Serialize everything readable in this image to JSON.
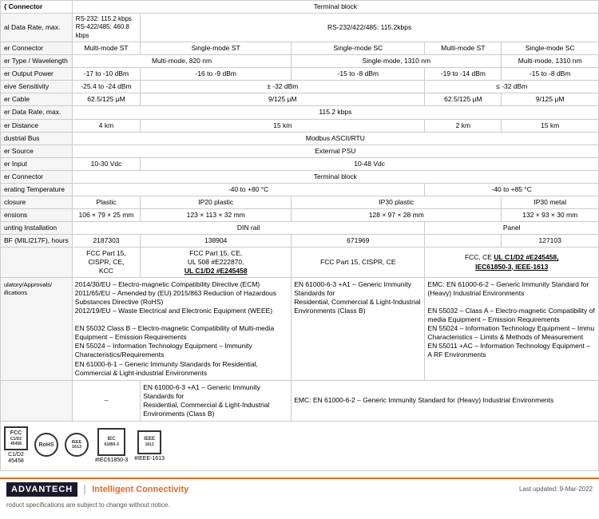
{
  "table": {
    "headers": {
      "col1": "",
      "col2": "Terminal block",
      "col3": "RS-232/422/485: 115.2kbps",
      "col4": "",
      "col5": "",
      "col6": ""
    },
    "rows": [
      {
        "label": "{ Connector",
        "values": [
          "Terminal block",
          "",
          "",
          "",
          ""
        ]
      },
      {
        "label": "al Data Rate, max.",
        "values": [
          "RS-232: 115.2 kbps\nRS-422/485: 460.8 kbps",
          "RS-232/422/485: 115.2kbps",
          "",
          "",
          ""
        ]
      },
      {
        "label": "er Connector",
        "values": [
          "Multi-mode ST",
          "Single-mode ST",
          "Single-mode SC",
          "Multi-mode ST",
          "Single-mode SC"
        ]
      },
      {
        "label": "er Type / Wavelength",
        "values": [
          "Multi-mode, 820 nm",
          "Single-mode, 1310 nm",
          "",
          "Multi-mode, 1310 nm",
          "Single-mode, 1310"
        ]
      },
      {
        "label": "er Output Power",
        "values": [
          "-17 to -10 dBm",
          "-16 to -9 dBm",
          "-15 to -8 dBm",
          "-19 to -14 dBm",
          "-15 to -8 dBm"
        ]
      },
      {
        "label": "eive Sensitivity",
        "values": [
          "-25.4 to -24 dBm",
          "± -32 dBm",
          "",
          "≤ -32 dBm",
          ""
        ]
      },
      {
        "label": "er Cable",
        "values": [
          "62.5/125 μM",
          "9/125 μM",
          "",
          "62.5/125 μM",
          "9/125 μM"
        ]
      },
      {
        "label": "er Data Rate, max.",
        "values": [
          "115.2 kbps",
          "",
          "",
          "",
          ""
        ]
      },
      {
        "label": "er Distance",
        "values": [
          "4 km",
          "15 km",
          "",
          "2 km",
          "15 km"
        ]
      },
      {
        "label": "dustrial Bus",
        "values": [
          "Modbus ASCII/RTU",
          "",
          "",
          "",
          ""
        ]
      },
      {
        "label": "er Source",
        "values": [
          "External PSU",
          "",
          "",
          "",
          ""
        ]
      },
      {
        "label": "er Input",
        "values": [
          "10-30 Vdc",
          "10-48 Vdc",
          "",
          "",
          ""
        ]
      },
      {
        "label": "er Connector",
        "values": [
          "Terminal block",
          "",
          "",
          "",
          ""
        ]
      },
      {
        "label": "erating Temperature",
        "values": [
          "-40 to +80 °C",
          "",
          "",
          "-40 to +85 °C",
          ""
        ]
      },
      {
        "label": "closure",
        "values": [
          "Plastic",
          "IP20 plastic",
          "IP30 plastic",
          "",
          "IP30 metal"
        ]
      },
      {
        "label": "ensions",
        "values": [
          "106 × 79 × 25 mm",
          "123 × 113 × 32 mm",
          "128 × 97 × 28 mm",
          "",
          "132 × 93 × 30 mm"
        ]
      },
      {
        "label": "unting Installation",
        "values": [
          "DIN rail",
          "",
          "",
          "Panel",
          ""
        ]
      },
      {
        "label": "BF (MILI217F), hours",
        "values": [
          "2187303",
          "138904",
          "671969",
          "",
          "127103"
        ]
      },
      {
        "label": "",
        "values": [
          "FCC Part 15, CISPR, CE, KCC",
          "FCC Part 15, CE,\nUL 508 #E222870,\nUL C1/D2 #E245458",
          "FCC Part 15, CISPR, CE",
          "FCC, CE UL C1/D2 #E245458,\nIEC61850-3, IEEE-1613",
          ""
        ]
      }
    ],
    "reg_row": {
      "label": "ulatory/Approvals/\nifications",
      "col_left": "2014/30/EU – Electro-magnetic Compatibility Directive (ECM)\n2011/65/EU – Amended by (EU) 2015/863 Reduction of Hazardous Substances Directive (RoHS)\n2012/19/EU – Waste Electrical and Electronic Equipment (WEEE)\n\nEN 55032 Class B – Electro-magnetic Compatibility of Multi-media Equipment – Emission Requirements\nEN 55024 – Information Technology Equipment – Immunity Characteristics/Requirements\nEN 61000-6-1 – Generic Immunity Standards for Residential, Commercial & Light-industrial Environments",
      "col_mid": "EN 61000-6-3 +A1 – Generic Immunity Standards for\nResidential, Commercial & Light-Industrial Environments (Class B)",
      "col_right": "EMC: EN 61000-6-2 – Generic Immunity Standard for (Heavy) Industrial Environments\n\nEN 55032 – Class A – Electro-magnetic Compatibility of\nmedia Equipment – Emission Requirements\nEN 55024 – Information Technology Equipment – Immu\nCharacteristics – Limits & Methods of Measurement\nEN 55011 +AC – Information Technology Equipment –\nA RF Environments"
    }
  },
  "logos": [
    {
      "symbol": "FCC\nC1/D2\n45458",
      "type": "square"
    },
    {
      "symbol": "RoHS",
      "type": "circle"
    },
    {
      "symbol": "IEEE\n1613",
      "type": "circle"
    },
    {
      "symbol": "IEC\n61850-3",
      "type": "square",
      "label": "#IEC61850-3"
    },
    {
      "symbol": "IEEE\n1613",
      "type": "square",
      "label": "#IEEE-1613"
    }
  ],
  "logo_labels": [
    "C1/D2\n45458",
    "#IEC61850-3",
    "#IEEE-1613"
  ],
  "footer": {
    "brand": "ADVANTECH",
    "tagline": "Intelligent Connectivity",
    "notice": "roduct specifications are subject to change without notice.",
    "updated": "Last updated: 9-Mar-2022"
  },
  "connector_header": "Connector"
}
